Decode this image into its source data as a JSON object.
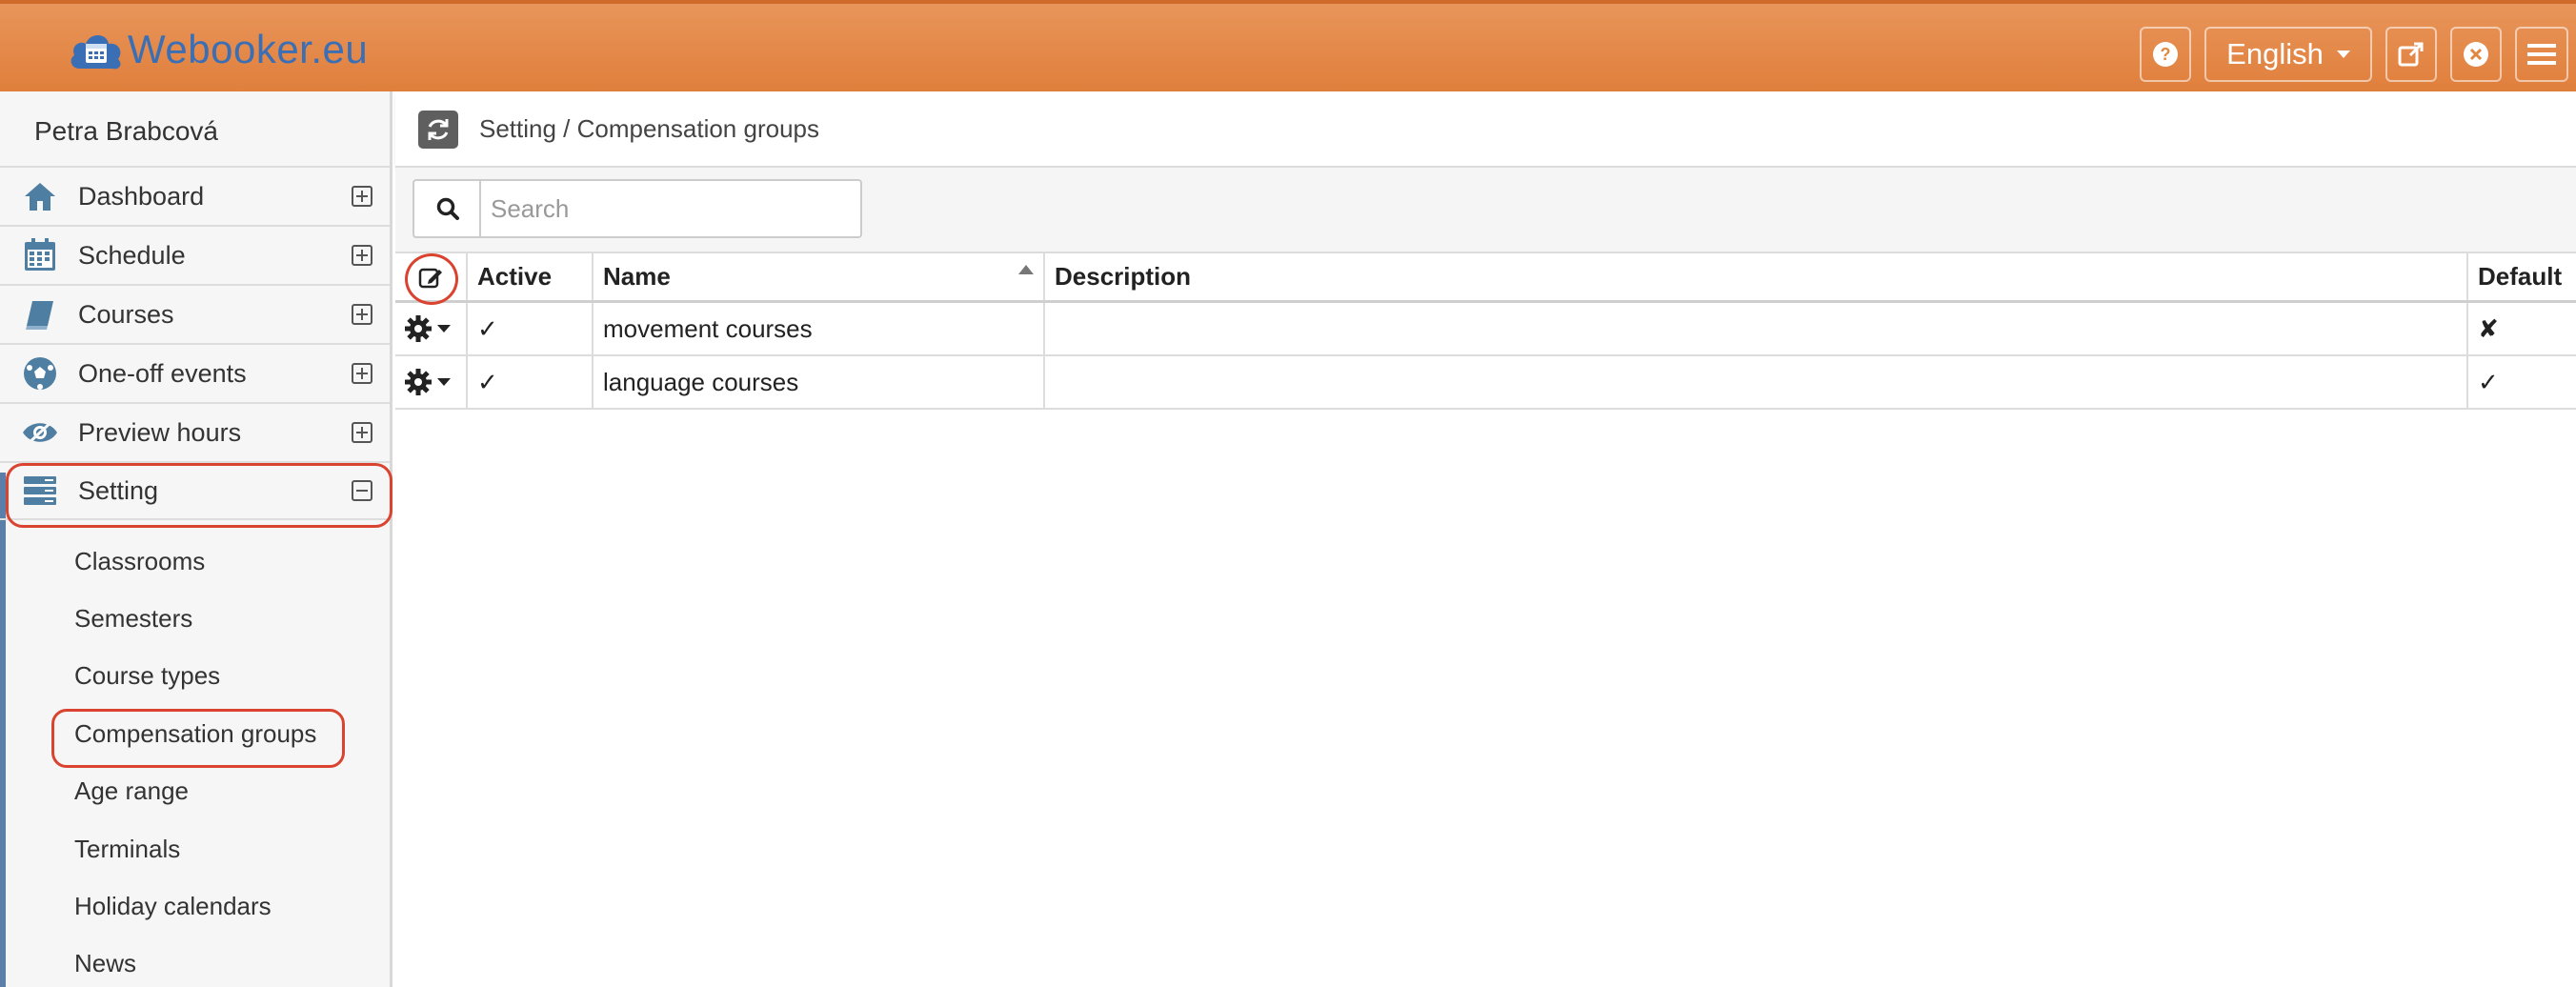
{
  "app": {
    "logo_text": "Webooker.eu",
    "language": "English",
    "colors": {
      "header": "#e28a48",
      "logo": "#3b6fb5",
      "highlight": "#d9432f",
      "icon": "#4f7ea3"
    }
  },
  "topbar": {
    "icons": [
      "help-icon",
      "external-link-icon",
      "close-icon",
      "menu-icon"
    ]
  },
  "sidebar": {
    "user_name": "Petra Brabcová",
    "items": [
      {
        "label": "Dashboard",
        "icon": "home-icon"
      },
      {
        "label": "Schedule",
        "icon": "calendar-icon"
      },
      {
        "label": "Courses",
        "icon": "book-icon"
      },
      {
        "label": "One-off events",
        "icon": "soccer-ball-icon"
      },
      {
        "label": "Preview hours",
        "icon": "eye-icon"
      },
      {
        "label": "Setting",
        "icon": "server-icon"
      }
    ],
    "subitems": [
      "Classrooms",
      "Semesters",
      "Course types",
      "Compensation groups",
      "Age range",
      "Terminals",
      "Holiday calendars",
      "News"
    ]
  },
  "breadcrumb": "Setting / Compensation groups",
  "search": {
    "placeholder": "Search",
    "value": ""
  },
  "table": {
    "columns": [
      "Active",
      "Name",
      "Description",
      "Default"
    ],
    "sort_column": "Name",
    "rows": [
      {
        "active": "✓",
        "name": "movement courses",
        "description": "",
        "default": "✘"
      },
      {
        "active": "✓",
        "name": "language courses",
        "description": "",
        "default": "✓"
      }
    ]
  }
}
